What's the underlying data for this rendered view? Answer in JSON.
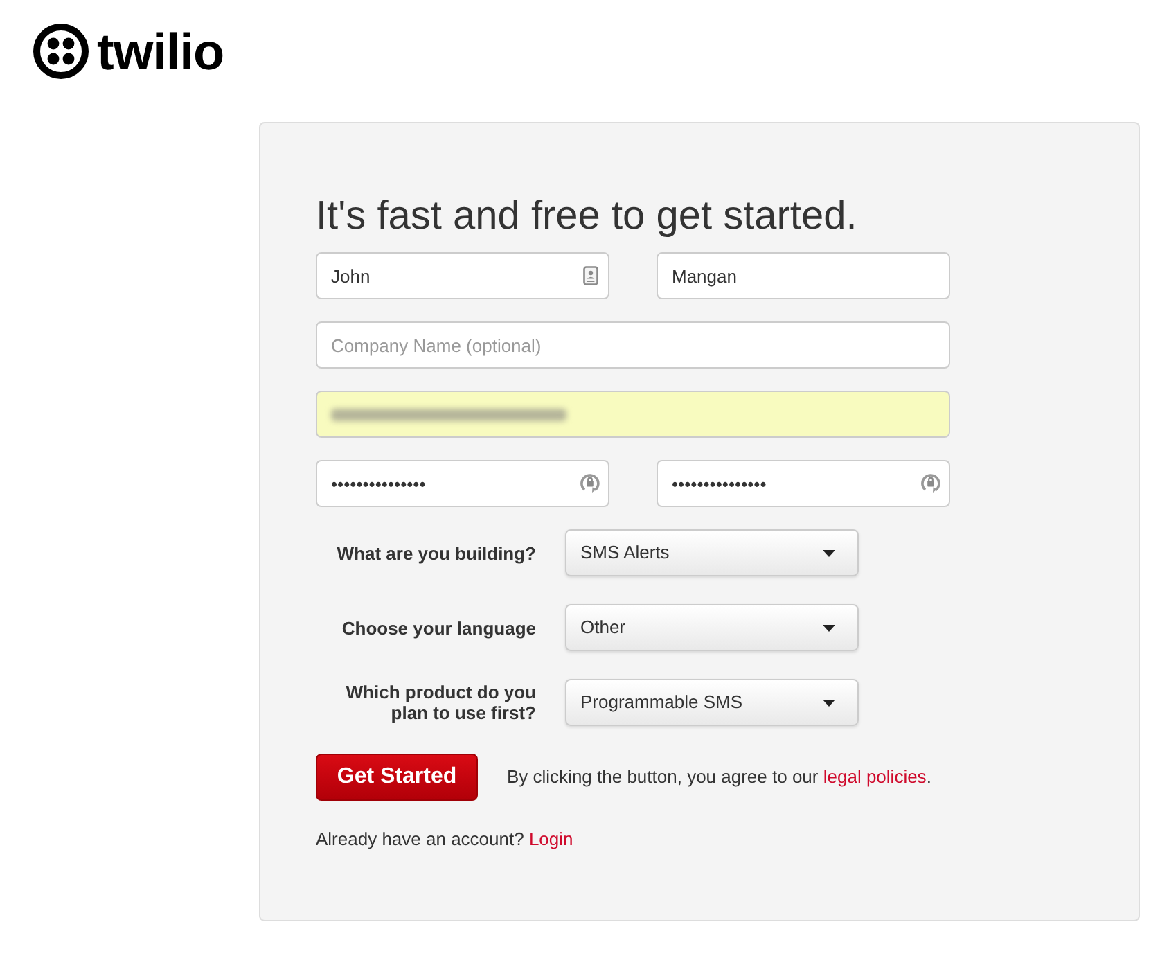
{
  "logo": {
    "text": "twilio"
  },
  "form": {
    "title": "It's fast and free to get started.",
    "field_rows": [
      {
        "fields": [
          {
            "kind": "contact",
            "value": "John",
            "autofilled": false
          },
          {
            "kind": "text",
            "value": "Mangan",
            "autofilled": false
          }
        ]
      },
      {
        "fields": [
          {
            "kind": "text",
            "placeholder": "Company Name (optional)",
            "autofilled": false
          }
        ]
      },
      {
        "fields": [
          {
            "kind": "redacted",
            "autofilled": true
          }
        ]
      },
      {
        "fields": [
          {
            "kind": "password",
            "value": "•••••••••••••••",
            "autofilled": false
          },
          {
            "kind": "password",
            "value": "•••••••••••••••",
            "autofilled": false
          }
        ]
      }
    ],
    "questions": [
      {
        "label": "What are you building?",
        "value": "SMS Alerts"
      },
      {
        "label": "Choose your language",
        "value": "Other"
      },
      {
        "label": "Which product do you plan to use first?",
        "value": "Programmable SMS"
      }
    ],
    "submit": {
      "label": "Get Started"
    },
    "agreement": {
      "text": "By clicking the button, you agree to our",
      "link": "legal policies",
      "after": "."
    },
    "login_prompt": {
      "text": "Already have an account?",
      "link": "Login"
    }
  }
}
